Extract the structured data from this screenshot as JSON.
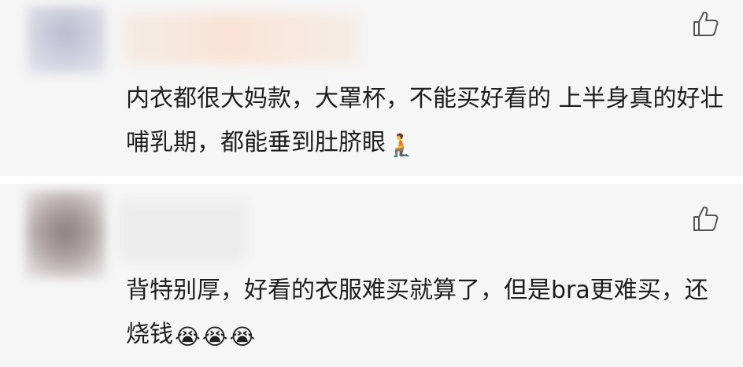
{
  "comments": [
    {
      "nickname": "",
      "text": "内衣都很大妈款，大罩杯，不能买好看的 上半身真的好壮 哺乳期，都能垂到肚脐眼",
      "emojis": [
        "🧎"
      ],
      "like_icon": "thumbs-up-outline-icon"
    },
    {
      "nickname": "",
      "text": "背特别厚，好看的衣服难买就算了，但是bra更难买，还烧钱",
      "emojis": [
        "😭",
        "😭",
        "😭"
      ],
      "like_icon": "thumbs-up-outline-icon"
    }
  ],
  "colors": {
    "card_bg": "#f6f6f6",
    "separator": "#ffffff",
    "text": "#1f1f1f",
    "icon": "#555555"
  }
}
